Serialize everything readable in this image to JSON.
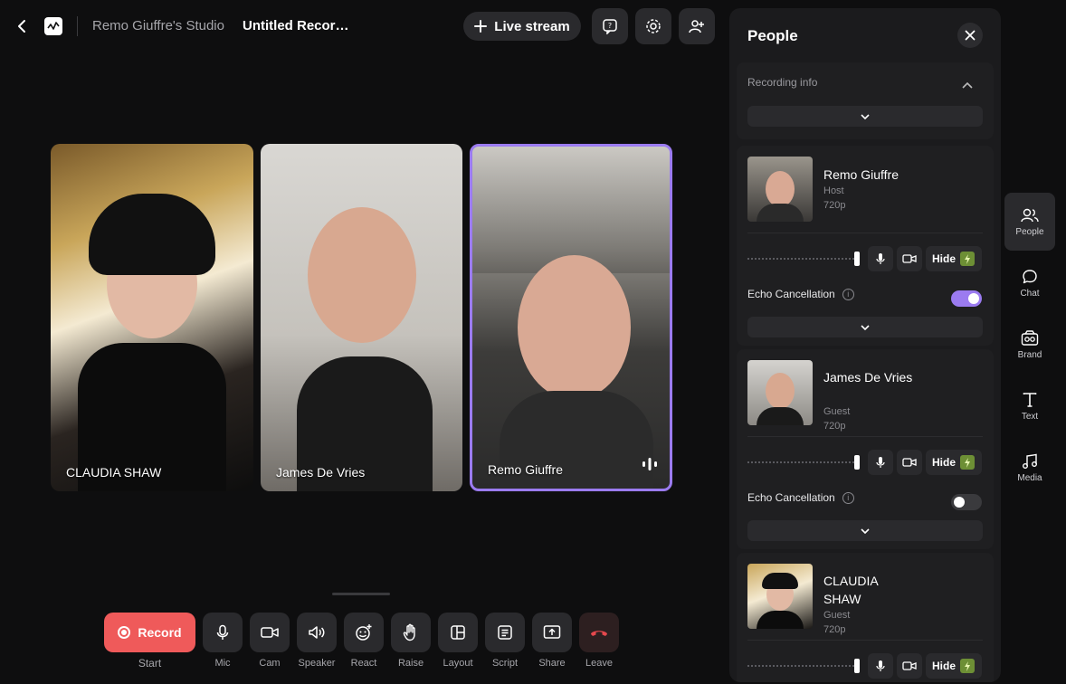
{
  "topbar": {
    "studio_name": "Remo Giuffre's Studio",
    "recording_title": "Untitled Recordi...",
    "live_stream_label": "Live stream"
  },
  "participants": [
    {
      "name": "CLAUDIA SHAW"
    },
    {
      "name": "James De Vries"
    },
    {
      "name": "Remo Giuffre",
      "speaking": true
    }
  ],
  "controls": {
    "record_label": "Record",
    "start_label": "Start",
    "items": [
      {
        "label": "Mic",
        "icon": "mic-icon"
      },
      {
        "label": "Cam",
        "icon": "camera-icon"
      },
      {
        "label": "Speaker",
        "icon": "speaker-icon"
      },
      {
        "label": "React",
        "icon": "emoji-icon"
      },
      {
        "label": "Raise",
        "icon": "hand-icon"
      },
      {
        "label": "Layout",
        "icon": "layout-icon"
      },
      {
        "label": "Script",
        "icon": "script-icon"
      },
      {
        "label": "Share",
        "icon": "share-screen-icon"
      },
      {
        "label": "Leave",
        "icon": "hang-up-icon"
      }
    ]
  },
  "panel": {
    "title": "People",
    "recording_info_label": "Recording info",
    "people": [
      {
        "name": "Remo Giuffre",
        "role": "Host",
        "resolution": "720p",
        "hide_label": "Hide",
        "echo_label": "Echo Cancellation",
        "echo_on": true
      },
      {
        "name": "James De Vries",
        "role": "Guest",
        "resolution": "720p",
        "hide_label": "Hide",
        "echo_label": "Echo Cancellation",
        "echo_on": false
      },
      {
        "name": "CLAUDIA SHAW",
        "role": "Guest",
        "resolution": "720p",
        "hide_label": "Hide"
      }
    ]
  },
  "rail": [
    {
      "label": "People",
      "icon": "people-icon",
      "active": true
    },
    {
      "label": "Chat",
      "icon": "chat-icon"
    },
    {
      "label": "Brand",
      "icon": "brand-icon"
    },
    {
      "label": "Text",
      "icon": "text-icon"
    },
    {
      "label": "Media",
      "icon": "media-icon"
    }
  ],
  "colors": {
    "accent": "#9b7bf0",
    "record": "#ef5a5a",
    "leave": "#e5484d",
    "boost": "#6d8f35"
  }
}
